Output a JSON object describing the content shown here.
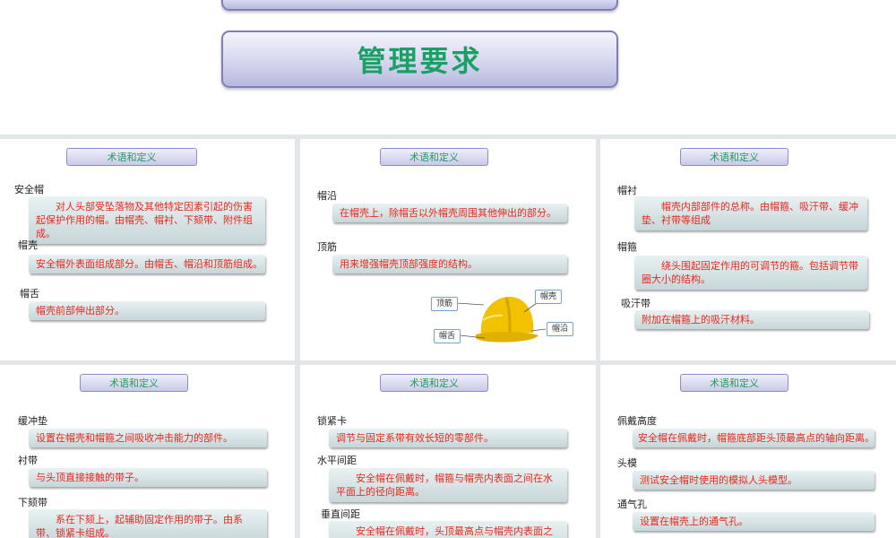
{
  "header": {
    "title": "管理要求"
  },
  "panels": [
    {
      "tab": "术语和定义",
      "items": [
        {
          "term": "安全帽",
          "definition": "对人头部受坠落物及其他特定因素引起的伤害起保护作用的帽。由帽壳、帽衬、下颏带、附件组成。"
        },
        {
          "term": "帽壳",
          "definition": "安全帽外表面组成部分。由帽舌、帽沿和顶筋组成。"
        },
        {
          "term": "帽舌",
          "definition": "帽壳前部伸出部分。"
        }
      ]
    },
    {
      "tab": "术语和定义",
      "items": [
        {
          "term": "帽沿",
          "definition": "在帽壳上，除帽舌以外帽壳周围其他伸出的部分。"
        },
        {
          "term": "顶筋",
          "definition": "用来增强帽壳顶部强度的结构。"
        }
      ],
      "diagram": {
        "labels": [
          "顶筋",
          "帽壳",
          "帽沿",
          "帽舌"
        ]
      }
    },
    {
      "tab": "术语和定义",
      "items": [
        {
          "term": "帽衬",
          "definition": "帽壳内部部件的总称。由帽箍、吸汗带、缓冲垫、衬带等组成"
        },
        {
          "term": "帽箍",
          "definition": "绕头围起固定作用的可调节的箍。包括调节带圈大小的结构。"
        },
        {
          "term": "吸汗带",
          "definition": "附加在帽箍上的吸汗材料。"
        }
      ]
    },
    {
      "tab": "术语和定义",
      "items": [
        {
          "term": "缓冲垫",
          "definition": "设置在帽壳和帽箍之间吸收冲击能力的部件。"
        },
        {
          "term": "衬带",
          "definition": "与头顶直接接触的带子。"
        },
        {
          "term": "下颏带",
          "definition": "系在下颏上，起辅助固定作用的带子。由系带、锁紧卡组成。"
        }
      ]
    },
    {
      "tab": "术语和定义",
      "items": [
        {
          "term": "锁紧卡",
          "definition": "调节与固定系带有效长短的零部件。"
        },
        {
          "term": "水平间距",
          "definition": "安全帽在佩戴时，帽箍与帽壳内表面之间在水平面上的径向距离。"
        },
        {
          "term": "垂直间距",
          "definition": "安全帽在佩戴时，头顶最高点与帽壳内表面之间的"
        }
      ]
    },
    {
      "tab": "术语和定义",
      "items": [
        {
          "term": "佩戴高度",
          "definition": "安全帽在佩戴时，帽箍底部距头顶最高点的轴向距离。"
        },
        {
          "term": "头模",
          "definition": "测试安全帽时使用的模拟人头模型。"
        },
        {
          "term": "通气孔",
          "definition": "设置在帽壳上的通气孔。"
        }
      ]
    }
  ],
  "colors": {
    "title_text": "#1aa065",
    "definition_text": "#e8281f",
    "tab_text": "#1f9a5d",
    "helmet": "#f2c200"
  },
  "icons": [
    "safety-helmet-icon"
  ]
}
